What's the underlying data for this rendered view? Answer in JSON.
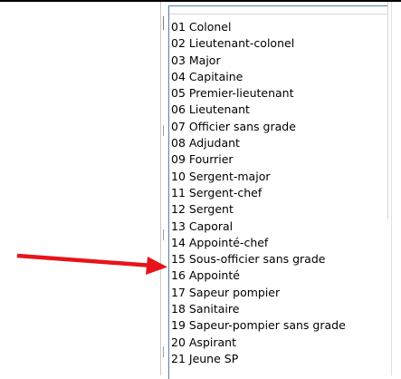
{
  "dropdown": {
    "options": [
      "01 Colonel",
      "02 Lieutenant-colonel",
      "03 Major",
      "04 Capitaine",
      "05 Premier-lieutenant",
      "06 Lieutenant",
      "07 Officier sans grade",
      "08 Adjudant",
      "09 Fourrier",
      "10 Sergent-major",
      "11 Sergent-chef",
      "12 Sergent",
      "13 Caporal",
      "14 Appointé-chef",
      "15 Sous-officier sans grade",
      "16 Appointé",
      "17 Sapeur pompier",
      "18 Sanitaire",
      "19 Sapeur-pompier sans grade",
      "20 Aspirant",
      "21 Jeune SP"
    ]
  },
  "annotation": {
    "arrow_color": "#e8141a",
    "points_to_option": "15 Sous-officier sans grade"
  }
}
